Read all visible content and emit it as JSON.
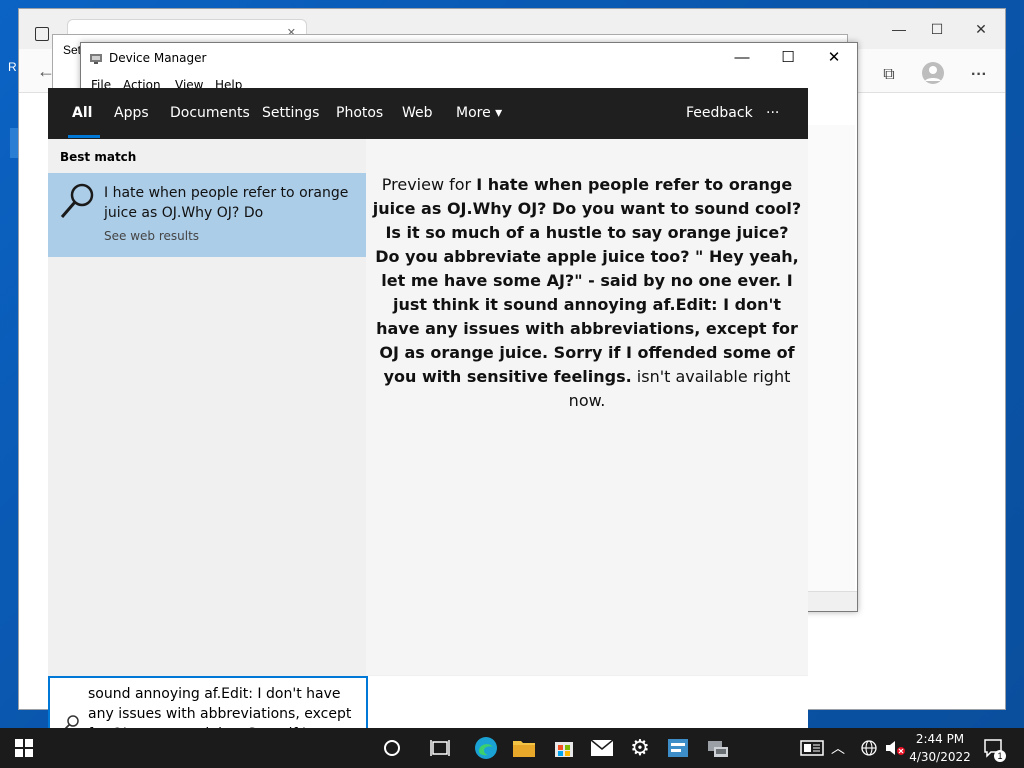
{
  "device_manager": {
    "title": "Device Manager",
    "menu": [
      "File",
      "Action",
      "View",
      "Help"
    ],
    "minimize": "—",
    "maximize": "☐",
    "close": "✕"
  },
  "settings": {
    "title": "Set"
  },
  "desktop": {
    "icon_letter_r": "R"
  },
  "search": {
    "tabs": [
      "All",
      "Apps",
      "Documents",
      "Settings",
      "Photos",
      "Web",
      "More"
    ],
    "more_chevron": "▾",
    "feedback": "Feedback",
    "ellipsis": "···",
    "best_match_label": "Best match",
    "best_match_title": "I hate when people refer to orange juice as OJ.Why OJ? Do",
    "best_match_sub": "See web results",
    "preview_prefix": "Preview for ",
    "preview_query": "I hate when people refer to orange juice as OJ.Why OJ? Do you want to sound cool? Is it so much of a hustle to say orange juice? Do you abbreviate apple juice too? \" Hey yeah, let me have some AJ?\" - said by no one ever. I just think it sound annoying af.Edit: I don't have any issues with abbreviations, except for OJ as orange juice. Sorry if I offended some of you with sensitive feelings.",
    "preview_suffix": " isn't available right now.",
    "box_text": "sound annoying af.Edit: I don't have any issues with abbreviations, except for OJ as orange juice. Sorry if I offended some of you with sensitive feelings."
  },
  "taskbar": {
    "time": "2:44 PM",
    "date": "4/30/2022",
    "notification_count": "1"
  }
}
